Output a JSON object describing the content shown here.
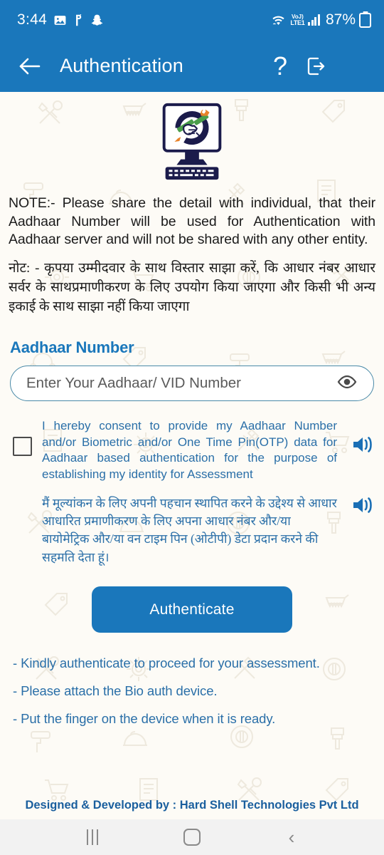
{
  "statusbar": {
    "time": "3:44",
    "battery_percent": "87%",
    "network_label_top": "VoJ)",
    "network_label_bottom": "LTE1",
    "icons": [
      "gallery-icon",
      "paytm-icon",
      "snapchat-icon",
      "wifi-icon",
      "volte-icon",
      "signal-bars-icon",
      "battery-charging-icon"
    ]
  },
  "appbar": {
    "back_label": "back-arrow",
    "title": "Authentication",
    "help_label": "?",
    "logout_label": "logout-icon",
    "menu_label": "menu-icon"
  },
  "main": {
    "logo_alt": "computer-with-tools-logo",
    "note_en": "NOTE:- Please share the detail with individual, that their Aadhaar Number will be used for Authentication with Aadhaar server and will not be shared with any other entity.",
    "note_hi": "नोट: - कृपया उम्मीदवार के साथ विस्तार साझा करें, कि आधार नंबर आधार सर्वर के साथप्रमाणीकरण के लिए उपयोग किया जाएगा और किसी भी अन्य इकाई के साथ साझा नहीं किया जाएगा",
    "aadhaar_label": "Aadhaar Number",
    "aadhaar_placeholder": "Enter Your Aadhaar/ VID Number",
    "aadhaar_value": "",
    "eye_icon": "eye-icon",
    "consent_en": "I hereby consent to provide my Aadhaar Number and/or Biometric and/or One Time Pin(OTP) data for Aadhaar based authentication for the purpose of establishing my identity for Assessment",
    "consent_hi": "मैं मूल्यांकन के लिए अपनी पहचान स्थापित करने के उद्देश्य से आधार आधारित प्रमाणीकरण के लिए अपना आधार नंबर और/या बायोमेट्रिक और/या वन टाइम पिन (ओटीपी) डेटा प्रदान करने की सहमति देता हूं।",
    "consent_checked": false,
    "speaker_icon": "speaker-icon",
    "authenticate_label": "Authenticate",
    "bullets": [
      "- Kindly authenticate to proceed for your assessment.",
      "- Please attach the Bio auth device.",
      "- Put the finger on the device when it is ready."
    ]
  },
  "footer": {
    "credit": "Designed & Developed by : Hard Shell Technologies Pvt Ltd"
  },
  "navbar": {
    "recents_label": "recents-button",
    "home_label": "home-button",
    "back_label": "back-button"
  },
  "colors": {
    "primary_blue": "#1a77bb",
    "text_blue": "#2a6fa8",
    "footer_blue": "#1a5f9e",
    "input_border": "#4a8aa8",
    "page_bg": "#fdfbf6"
  }
}
